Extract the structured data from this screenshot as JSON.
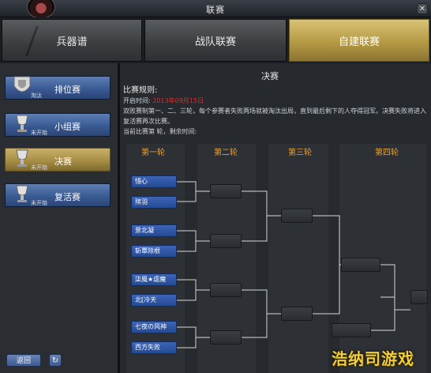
{
  "window": {
    "title": "联赛"
  },
  "tabs": [
    {
      "label": "兵器谱",
      "active": false
    },
    {
      "label": "战队联赛",
      "active": false
    },
    {
      "label": "自建联赛",
      "active": true
    }
  ],
  "sidebar": {
    "items": [
      {
        "label": "排位赛",
        "status": "淘汰",
        "active": false
      },
      {
        "label": "小组赛",
        "status": "未开始",
        "active": false
      },
      {
        "label": "决赛",
        "status": "未开始",
        "active": true
      },
      {
        "label": "复活赛",
        "status": "未开始",
        "active": false
      }
    ],
    "back_label": "返回",
    "refresh_icon": "↻"
  },
  "main": {
    "section_title": "决赛",
    "rules": {
      "heading": "比赛规则:",
      "start_label": "开启时间:",
      "start_time": "2013年09月15日",
      "text": "双败赛制第一、二、三轮，每个参赛者失败两场就被淘汰出局，直到最后剩下的人夺得冠军。决赛失败将进入复活赛再次比赛。",
      "current": "当前比赛第    轮，剩余时间:"
    },
    "rounds": [
      "第一轮",
      "第二轮",
      "第三轮",
      "第四轮"
    ],
    "players": [
      "惜心",
      "殡羽",
      "景北凝",
      "斩覃除根",
      "柒風★虐魔",
      "北[冷天",
      "七夜の风神",
      "西方失败"
    ]
  },
  "watermark": "浩纳司游戏网",
  "colors": {
    "active_gold": "#b59a45",
    "player_blue": "#244a93",
    "round_orange": "#e8a23a"
  }
}
